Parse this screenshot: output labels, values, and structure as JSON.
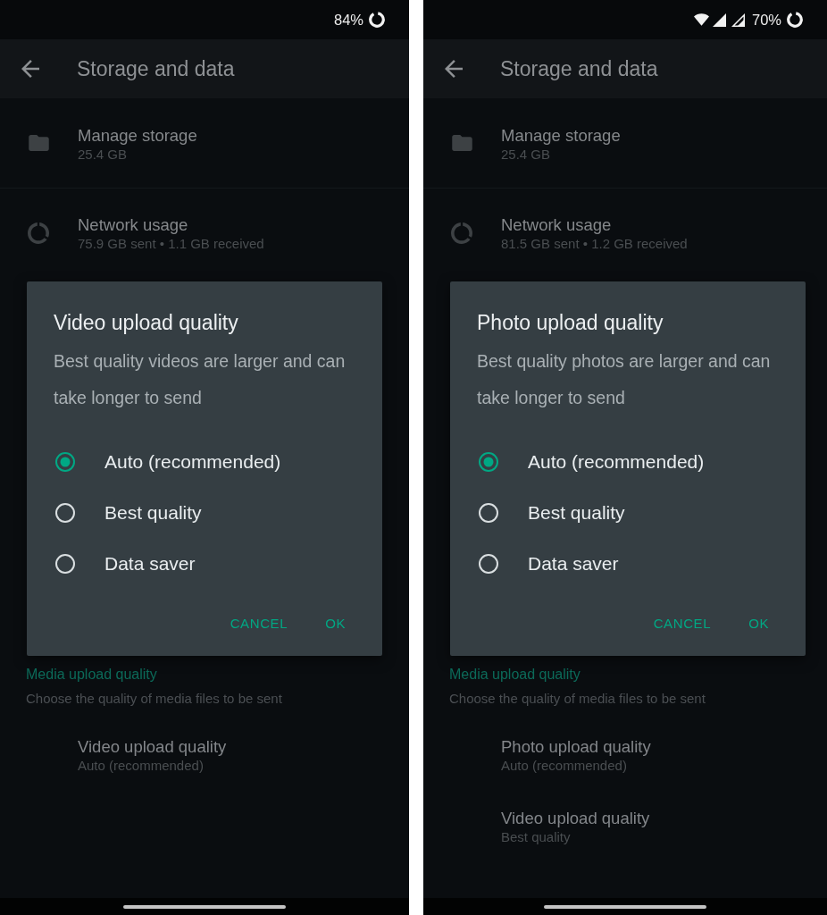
{
  "phones": [
    {
      "status_bar": {
        "wifi": false,
        "mobile_signal": false,
        "battery": "84%"
      },
      "app_bar": {
        "title": "Storage and data"
      },
      "settings": [
        {
          "kind": "storage",
          "title": "Manage storage",
          "subtitle": "25.4 GB"
        },
        {
          "kind": "network",
          "title": "Network usage",
          "subtitle": "75.9 GB sent • 1.1 GB received"
        }
      ],
      "dialog": {
        "title": "Video upload quality",
        "message": "Best quality videos are larger and can take longer to send",
        "options": [
          {
            "label": "Auto (recommended)",
            "selected": true
          },
          {
            "label": "Best quality",
            "selected": false
          },
          {
            "label": "Data saver",
            "selected": false
          }
        ],
        "buttons": [
          "CANCEL",
          "OK"
        ]
      },
      "media_section": {
        "header": "Media upload quality",
        "description": "Choose the quality of media files to be sent",
        "items": [
          {
            "title": "Video upload quality",
            "subtitle": "Auto (recommended)"
          }
        ]
      }
    },
    {
      "status_bar": {
        "wifi": true,
        "mobile_signal": true,
        "battery": "70%"
      },
      "app_bar": {
        "title": "Storage and data"
      },
      "settings": [
        {
          "kind": "storage",
          "title": "Manage storage",
          "subtitle": "25.4 GB"
        },
        {
          "kind": "network",
          "title": "Network usage",
          "subtitle": "81.5 GB sent • 1.2 GB received"
        }
      ],
      "dialog": {
        "title": "Photo upload quality",
        "message": "Best quality photos are larger and can take longer to send",
        "options": [
          {
            "label": "Auto (recommended)",
            "selected": true
          },
          {
            "label": "Best quality",
            "selected": false
          },
          {
            "label": "Data saver",
            "selected": false
          }
        ],
        "buttons": [
          "CANCEL",
          "OK"
        ]
      },
      "media_section": {
        "header": "Media upload quality",
        "description": "Choose the quality of media files to be sent",
        "items": [
          {
            "title": "Photo upload quality",
            "subtitle": "Auto (recommended)"
          },
          {
            "title": "Video upload quality",
            "subtitle": "Best quality"
          }
        ]
      }
    }
  ]
}
